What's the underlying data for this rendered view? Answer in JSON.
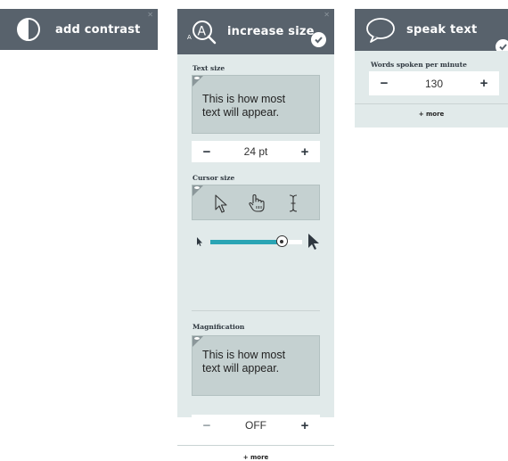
{
  "contrast": {
    "title": "add contrast"
  },
  "size": {
    "title": "increase size",
    "text_size_label": "Text size",
    "text_preview_line1": "This is how most",
    "text_preview_line2": "text will appear.",
    "text_size_value": "24 pt",
    "minus": "−",
    "plus": "+",
    "cursor_label": "Cursor size",
    "cursor_slider_fraction": 0.78,
    "magnification_label": "Magnification",
    "mag_preview_line1": "This is how most",
    "mag_preview_line2": "text will appear.",
    "magnification_value": "OFF",
    "more": "+ more"
  },
  "speak": {
    "title": "speak text",
    "wpm_label": "Words spoken per minute",
    "wpm_value": "130",
    "minus": "−",
    "plus": "+",
    "more": "+ more"
  },
  "colors": {
    "header": "#58626c",
    "body": "#e1eaea",
    "accent": "#2aa4b4",
    "preview": "#c5d1d1"
  }
}
